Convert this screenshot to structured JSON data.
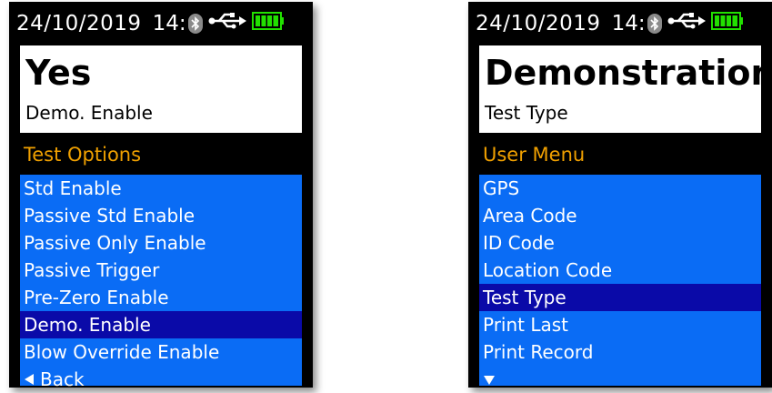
{
  "left": {
    "status": {
      "date": "24/10/2019",
      "time": "14:"
    },
    "value": {
      "main": "Yes",
      "sub": "Demo. Enable"
    },
    "menu_header": "Test Options",
    "items": [
      {
        "label": "Std Enable",
        "selected": false
      },
      {
        "label": "Passive Std Enable",
        "selected": false
      },
      {
        "label": "Passive Only Enable",
        "selected": false
      },
      {
        "label": "Passive Trigger",
        "selected": false
      },
      {
        "label": "Pre-Zero Enable",
        "selected": false
      },
      {
        "label": "Demo. Enable",
        "selected": true
      },
      {
        "label": "Blow Override Enable",
        "selected": false
      }
    ],
    "back_label": "Back"
  },
  "right": {
    "status": {
      "date": "24/10/2019",
      "time": "14:"
    },
    "value": {
      "main": "Demonstration",
      "sub": "Test Type"
    },
    "menu_header": "User Menu",
    "items": [
      {
        "label": "GPS",
        "selected": false
      },
      {
        "label": "Area Code",
        "selected": false
      },
      {
        "label": "ID Code",
        "selected": false
      },
      {
        "label": "Location Code",
        "selected": false
      },
      {
        "label": "Test Type",
        "selected": true
      },
      {
        "label": "Print Last",
        "selected": false
      },
      {
        "label": "Print Record",
        "selected": false
      }
    ]
  },
  "colors": {
    "list_bg": "#0a6cf5",
    "selected_bg": "#0a0aa8",
    "header_text": "#f0a000",
    "battery": "#22e000"
  },
  "icons": [
    "bluetooth-icon",
    "usb-icon",
    "battery-icon",
    "back-arrow-icon",
    "scroll-down-icon"
  ]
}
